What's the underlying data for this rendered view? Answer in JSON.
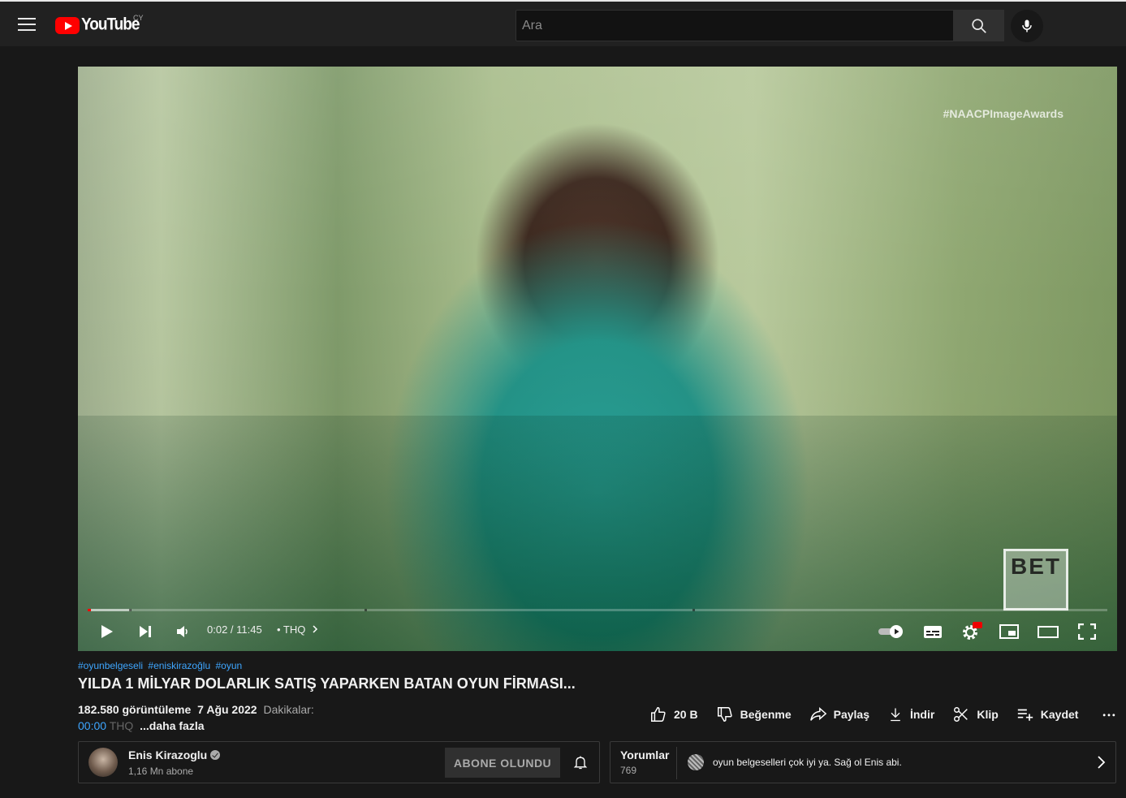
{
  "masthead": {
    "logo_text": "YouTube",
    "country_code": "CY",
    "search_placeholder": "Ara"
  },
  "player": {
    "watermark": "#NAACPImageAwards",
    "network_logo": "BET",
    "current_time": "0:02",
    "duration": "11:45",
    "time_display": "0:02 / 11:45",
    "chapter_label": "• THQ",
    "played_fraction": 0.003,
    "buffered_fraction": 0.042,
    "quality_badge": "HD",
    "autoplay_on": true
  },
  "video": {
    "hashtags": [
      "#oyunbelgeseli",
      "#eniskirazoğlu",
      "#oyun"
    ],
    "title": "YILDA 1 MİLYAR DOLARLIK SATIŞ YAPARKEN BATAN OYUN FİRMASI...",
    "views": "182.580 görüntüleme",
    "date": "7 Ağu 2022",
    "desc_start": "Dakikalar:",
    "timestamp": "00:00",
    "timestamp_suffix": "THQ",
    "more_label": "...daha fazla"
  },
  "actions": {
    "like_count": "20 B",
    "dislike_label": "Beğenme",
    "share_label": "Paylaş",
    "download_label": "İndir",
    "clip_label": "Klip",
    "save_label": "Kaydet"
  },
  "channel": {
    "name": "Enis Kirazoglu",
    "subscribers": "1,16 Mn abone",
    "subscribe_label": "ABONE OLUNDU"
  },
  "comments": {
    "title": "Yorumlar",
    "count": "769",
    "top_comment": "oyun belgeselleri çok iyi ya. Sağ ol Enis abi."
  },
  "colors": {
    "accent_red": "#ff0000",
    "link_blue": "#3ea6ff",
    "background": "#181818"
  }
}
